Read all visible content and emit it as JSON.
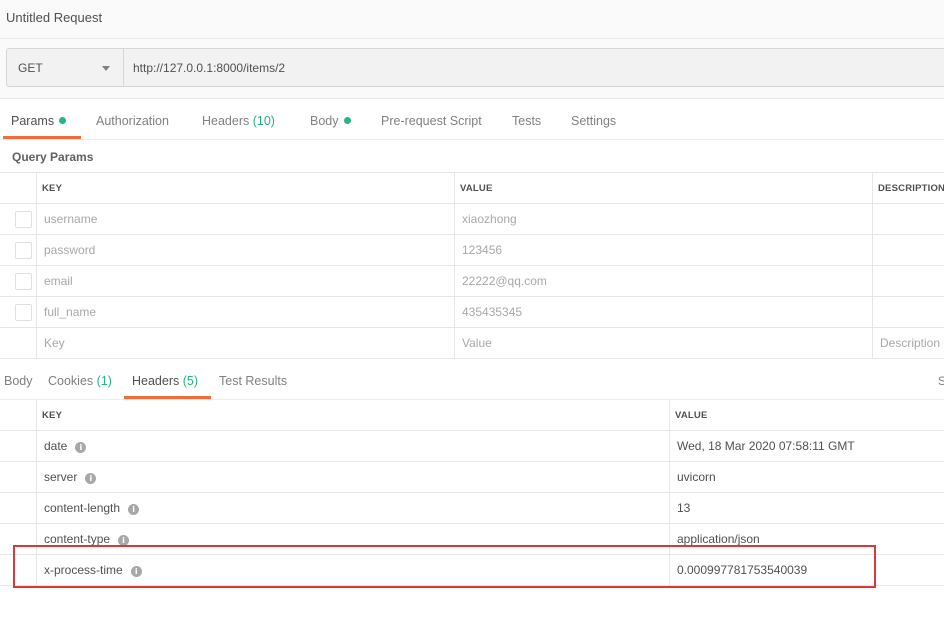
{
  "title": "Untitled Request",
  "request": {
    "method": "GET",
    "url": "http://127.0.0.1:8000/items/2"
  },
  "request_tabs": [
    {
      "label": "Params",
      "dot": true,
      "active": true
    },
    {
      "label": "Authorization"
    },
    {
      "label": "Headers",
      "count": "(10)"
    },
    {
      "label": "Body",
      "dot": true
    },
    {
      "label": "Pre-request Script"
    },
    {
      "label": "Tests"
    },
    {
      "label": "Settings"
    }
  ],
  "query_params": {
    "label": "Query Params",
    "columns": [
      "KEY",
      "VALUE",
      "DESCRIPTION"
    ],
    "rows": [
      {
        "key": "username",
        "value": "xiaozhong"
      },
      {
        "key": "password",
        "value": "123456"
      },
      {
        "key": "email",
        "value": "22222@qq.com"
      },
      {
        "key": "full_name",
        "value": "435435345"
      }
    ],
    "placeholder": {
      "key": "Key",
      "value": "Value",
      "description": "Description"
    }
  },
  "response_tabs": [
    {
      "label": "Body"
    },
    {
      "label": "Cookies",
      "count": "(1)"
    },
    {
      "label": "Headers",
      "count": "(5)",
      "active": true
    },
    {
      "label": "Test Results"
    }
  ],
  "response_tabs_right_text": "S",
  "response_headers": {
    "columns": [
      "KEY",
      "VALUE"
    ],
    "rows": [
      {
        "key": "date",
        "value": "Wed, 18 Mar 2020 07:58:11 GMT"
      },
      {
        "key": "server",
        "value": "uvicorn"
      },
      {
        "key": "content-length",
        "value": "13"
      },
      {
        "key": "content-type",
        "value": "application/json"
      },
      {
        "key": "x-process-time",
        "value": "0.000997781753540039"
      }
    ]
  },
  "colors": {
    "accent": "#f26b3a",
    "success": "#26b47f",
    "highlight": "#d83a3a"
  }
}
